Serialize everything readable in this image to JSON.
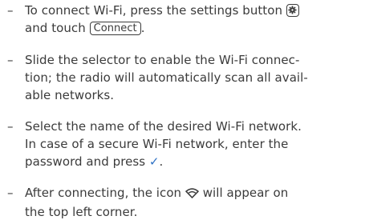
{
  "bullets": [
    {
      "dash": "–",
      "line1_pre": "To connect Wi-Fi, press the settings button ",
      "line2_pre": "and touch ",
      "connect_label": "Connect",
      "line2_post": ".",
      "icon": "settings-gear-icon"
    },
    {
      "dash": "–",
      "line1": "Slide the selector to enable the Wi-Fi connec-",
      "line2": "tion; the radio will automatically scan all avail-",
      "line3": "able networks."
    },
    {
      "dash": "–",
      "line1": "Select the name of the desired Wi-Fi network.",
      "line2": "In case of a secure Wi-Fi network, enter the",
      "line3_pre": "password and press ",
      "check": "✓",
      "line3_post": ".",
      "accent_color": "#2f72c5"
    },
    {
      "dash": "–",
      "line1_pre": "After connecting, the icon ",
      "line1_post": " will appear on",
      "line2": "the top left corner.",
      "icon": "wifi-icon"
    }
  ]
}
